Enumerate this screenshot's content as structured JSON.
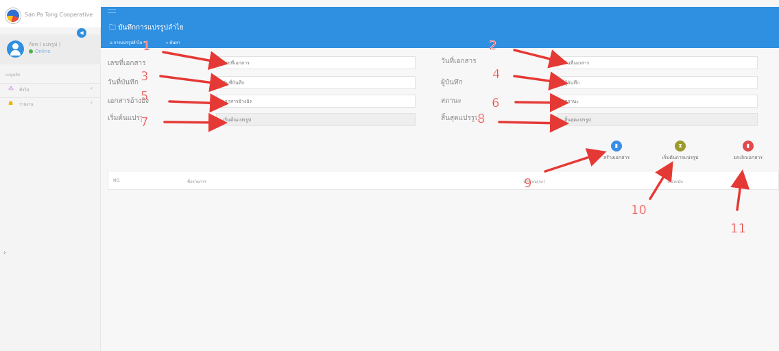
{
  "sidebar": {
    "brand_name": "San Pa Tong Cooperative",
    "collapse_icon": "sidebar-toggle-icon",
    "user_name": "กัลท ( แปรรูป )",
    "user_status": "Online",
    "menu_header": "เมนูหลัก",
    "items": [
      {
        "label": "ทั่วไป",
        "icon": "⁂",
        "icon_color": "#c77ddb"
      },
      {
        "label": "รายงาน",
        "icon": "☗",
        "icon_color": "#f0b400"
      }
    ]
  },
  "header": {
    "page_title": "บันทึกการแปรรูปลำไย",
    "tabs": [
      {
        "label": "การแปรรูปลำไย",
        "icon": "home-icon"
      },
      {
        "label": "ค้นหา",
        "icon": "search-icon"
      }
    ]
  },
  "form": {
    "doc_no": {
      "label": "เลขที่เอกสาร",
      "placeholder": "เลขที่เอกสาร"
    },
    "doc_date": {
      "label": "วันที่เอกสาร",
      "placeholder": "วันที่เอกสาร"
    },
    "record_date": {
      "label": "วันที่บันทึก",
      "placeholder": "วันที่บันทึก"
    },
    "recorder": {
      "label": "ผู้บันทึก",
      "placeholder": "ผู้บันทึก"
    },
    "ref_doc": {
      "label": "เอกสารอ้างอิง",
      "placeholder": "เอกสารอ้างอิง"
    },
    "status": {
      "label": "สถานะ",
      "placeholder": "สถานะ"
    },
    "start": {
      "label": "เริ่มต้นแปรรูป",
      "placeholder": "เริ่มต้นแปรรูป"
    },
    "end": {
      "label": "สิ้นสุดแปรรูป",
      "placeholder": "สิ้นสุดแปรรูป"
    }
  },
  "actions": {
    "create": {
      "label": "สร้างเอกสาร",
      "color": "#3a8ee6"
    },
    "start_process": {
      "label": "เริ่มต้นการแปรรูป",
      "color": "#9c9a2a"
    },
    "cancel": {
      "label": "ยกเลิกเอกสาร",
      "color": "#e04a4a"
    }
  },
  "table": {
    "columns": [
      "NO.",
      "ชื่อรายการ",
      "ปริมาณ(กก)",
      "หน่วยนับ"
    ]
  },
  "annotations": [
    "1",
    "2",
    "3",
    "4",
    "5",
    "6",
    "7",
    "8",
    "9",
    "10",
    "11"
  ],
  "colors": {
    "accent": "#2f8fe0",
    "annotation": "#e53935"
  }
}
